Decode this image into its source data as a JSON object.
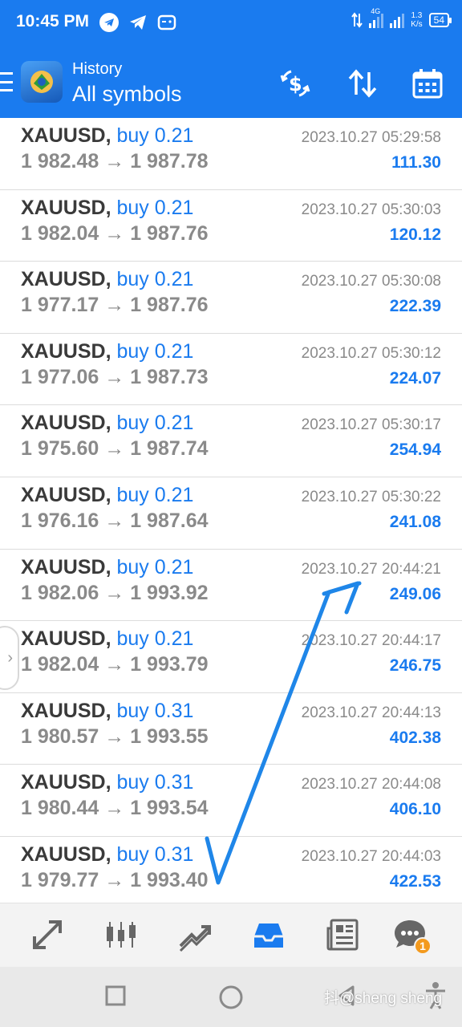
{
  "status_bar": {
    "time": "10:45 PM",
    "network_label": "4G",
    "speed_value": "1.3",
    "speed_unit": "K/s",
    "battery": "54"
  },
  "header": {
    "subtitle": "History",
    "title": "All symbols",
    "actions": [
      "currency-exchange-icon",
      "sort-icon",
      "calendar-icon"
    ]
  },
  "trades": [
    {
      "symbol": "XAUUSD,",
      "side": "buy 0.21",
      "prices": "1 982.48 → 1 987.78",
      "time": "2023.10.27 05:29:58",
      "profit": "111.30"
    },
    {
      "symbol": "XAUUSD,",
      "side": "buy 0.21",
      "prices": "1 982.04 → 1 987.76",
      "time": "2023.10.27 05:30:03",
      "profit": "120.12"
    },
    {
      "symbol": "XAUUSD,",
      "side": "buy 0.21",
      "prices": "1 977.17 → 1 987.76",
      "time": "2023.10.27 05:30:08",
      "profit": "222.39"
    },
    {
      "symbol": "XAUUSD,",
      "side": "buy 0.21",
      "prices": "1 977.06 → 1 987.73",
      "time": "2023.10.27 05:30:12",
      "profit": "224.07"
    },
    {
      "symbol": "XAUUSD,",
      "side": "buy 0.21",
      "prices": "1 975.60 → 1 987.74",
      "time": "2023.10.27 05:30:17",
      "profit": "254.94"
    },
    {
      "symbol": "XAUUSD,",
      "side": "buy 0.21",
      "prices": "1 976.16 → 1 987.64",
      "time": "2023.10.27 05:30:22",
      "profit": "241.08"
    },
    {
      "symbol": "XAUUSD,",
      "side": "buy 0.21",
      "prices": "1 982.06 → 1 993.92",
      "time": "2023.10.27 20:44:21",
      "profit": "249.06"
    },
    {
      "symbol": "XAUUSD,",
      "side": "buy 0.21",
      "prices": "1 982.04 → 1 993.79",
      "time": "2023.10.27 20:44:17",
      "profit": "246.75"
    },
    {
      "symbol": "XAUUSD,",
      "side": "buy 0.31",
      "prices": "1 980.57 → 1 993.55",
      "time": "2023.10.27 20:44:13",
      "profit": "402.38"
    },
    {
      "symbol": "XAUUSD,",
      "side": "buy 0.31",
      "prices": "1 980.44 → 1 993.54",
      "time": "2023.10.27 20:44:08",
      "profit": "406.10"
    },
    {
      "symbol": "XAUUSD,",
      "side": "buy 0.31",
      "prices": "1 979.77 → 1 993.40",
      "time": "2023.10.27 20:44:03",
      "profit": "422.53"
    }
  ],
  "bottom_nav": {
    "items": [
      "quotes-icon",
      "chart-icon",
      "trade-icon",
      "history-icon",
      "news-icon",
      "messages-icon"
    ],
    "active": "history-icon",
    "messages_badge": "1"
  },
  "watermark": "抖@sheng sheng",
  "colors": {
    "accent": "#1a7bef",
    "profit": "#1a7bef",
    "badge": "#f39a1e",
    "annotation": "#1f86e8"
  }
}
